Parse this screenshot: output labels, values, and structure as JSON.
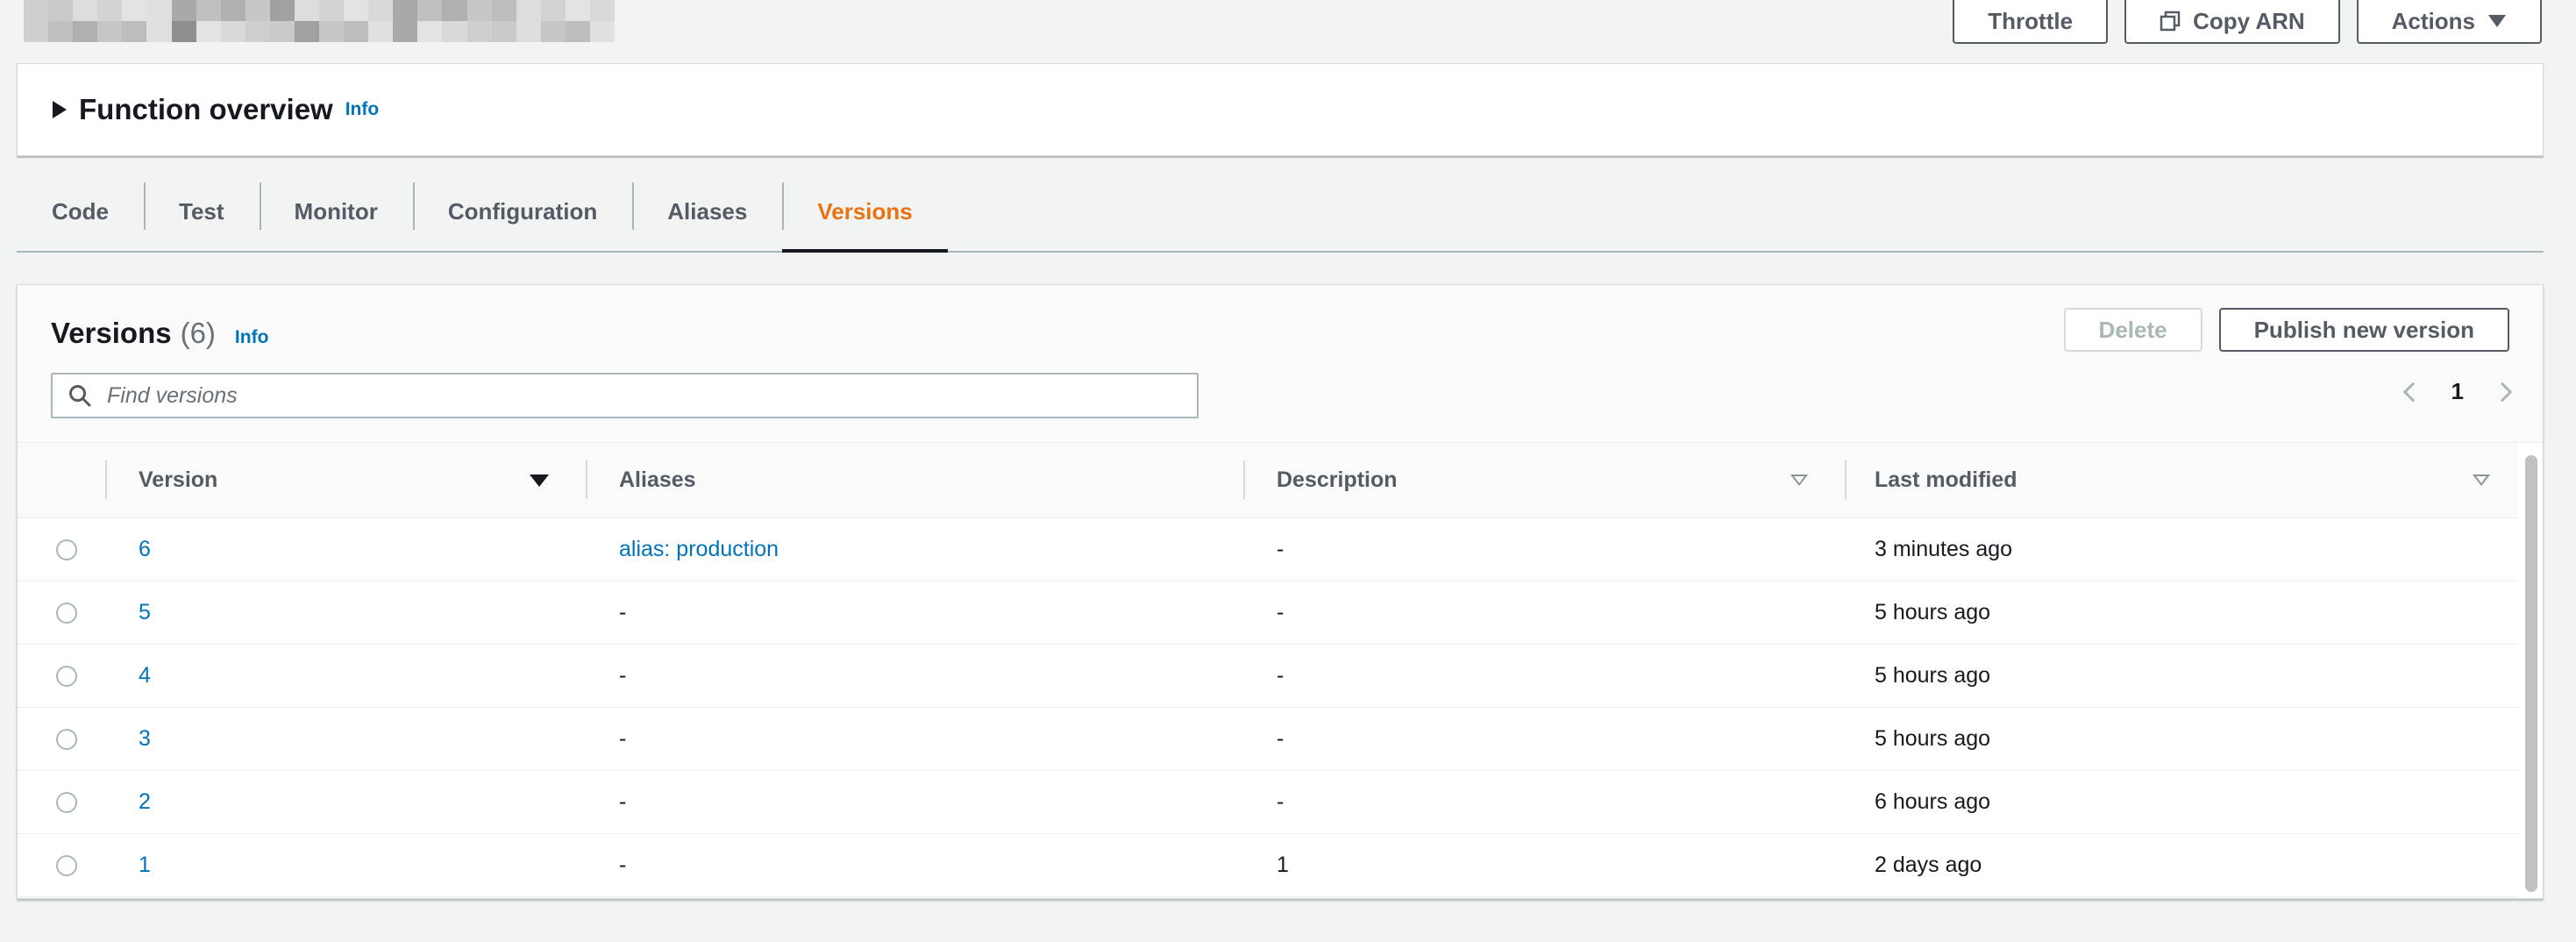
{
  "header": {
    "buttons": {
      "throttle": "Throttle",
      "copy_arn": "Copy ARN",
      "actions": "Actions"
    }
  },
  "overview": {
    "title": "Function overview",
    "info": "Info"
  },
  "tabs": [
    {
      "label": "Code"
    },
    {
      "label": "Test"
    },
    {
      "label": "Monitor"
    },
    {
      "label": "Configuration"
    },
    {
      "label": "Aliases"
    },
    {
      "label": "Versions",
      "active": true
    }
  ],
  "versions": {
    "title": "Versions",
    "count": "(6)",
    "info": "Info",
    "delete_label": "Delete",
    "publish_label": "Publish new version",
    "search_placeholder": "Find versions",
    "page": "1",
    "columns": {
      "version": "Version",
      "aliases": "Aliases",
      "description": "Description",
      "last_modified": "Last modified"
    },
    "rows": [
      {
        "version": "6",
        "aliases": "alias: production",
        "description": "-",
        "last_modified": "3 minutes ago"
      },
      {
        "version": "5",
        "aliases": "-",
        "description": "-",
        "last_modified": "5 hours ago"
      },
      {
        "version": "4",
        "aliases": "-",
        "description": "-",
        "last_modified": "5 hours ago"
      },
      {
        "version": "3",
        "aliases": "-",
        "description": "-",
        "last_modified": "5 hours ago"
      },
      {
        "version": "2",
        "aliases": "-",
        "description": "-",
        "last_modified": "6 hours ago"
      },
      {
        "version": "1",
        "aliases": "-",
        "description": "1",
        "last_modified": "2 days ago"
      }
    ]
  },
  "colors": {
    "accent_active_tab": "#ec7211",
    "link": "#0073bb",
    "text": "#16191f",
    "secondary_text": "#545b64",
    "border": "#aab7b8",
    "background": "#f2f3f3"
  }
}
